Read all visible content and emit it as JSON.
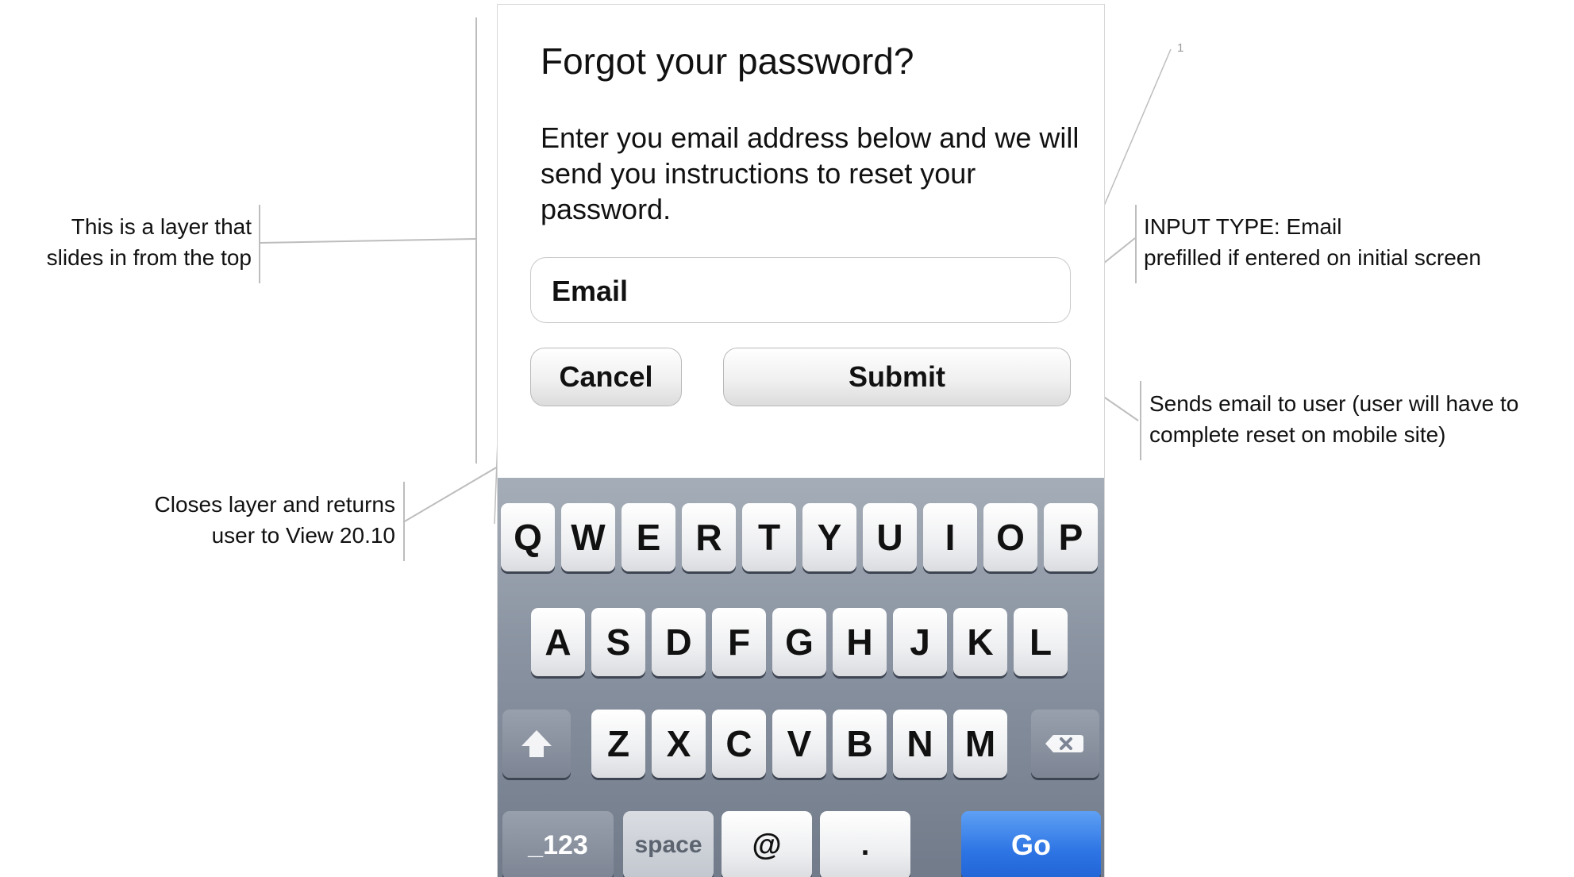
{
  "annotations": {
    "layer": [
      "This is a layer that",
      "slides in from the top"
    ],
    "input_type": [
      "INPUT TYPE: Email",
      "prefilled if entered on initial screen"
    ],
    "sends_email": [
      "Sends email to user (user will have to",
      "complete reset on mobile site)"
    ],
    "closes_layer": [
      "Closes layer and returns",
      "user to View 20.10"
    ],
    "marker": "1"
  },
  "dialog": {
    "title": "Forgot your password?",
    "body": "Enter you email address below and we will send you instructions to reset your password.",
    "email_placeholder": "Email",
    "cancel_label": "Cancel",
    "submit_label": "Submit"
  },
  "keyboard": {
    "row1": [
      "Q",
      "W",
      "E",
      "R",
      "T",
      "Y",
      "U",
      "I",
      "O",
      "P"
    ],
    "row2": [
      "A",
      "S",
      "D",
      "F",
      "G",
      "H",
      "J",
      "K",
      "L"
    ],
    "row3": [
      "Z",
      "X",
      "C",
      "V",
      "B",
      "N",
      "M"
    ],
    "numbers_label": "_123",
    "space_label": "space",
    "at_label": "@",
    "dot_label": ".",
    "go_label": "Go",
    "shift_icon": "shift-arrow-icon",
    "delete_icon": "backspace-icon"
  },
  "colors": {
    "go_key": "#2d74e4",
    "keyboard_bg": "#8b94a2"
  }
}
